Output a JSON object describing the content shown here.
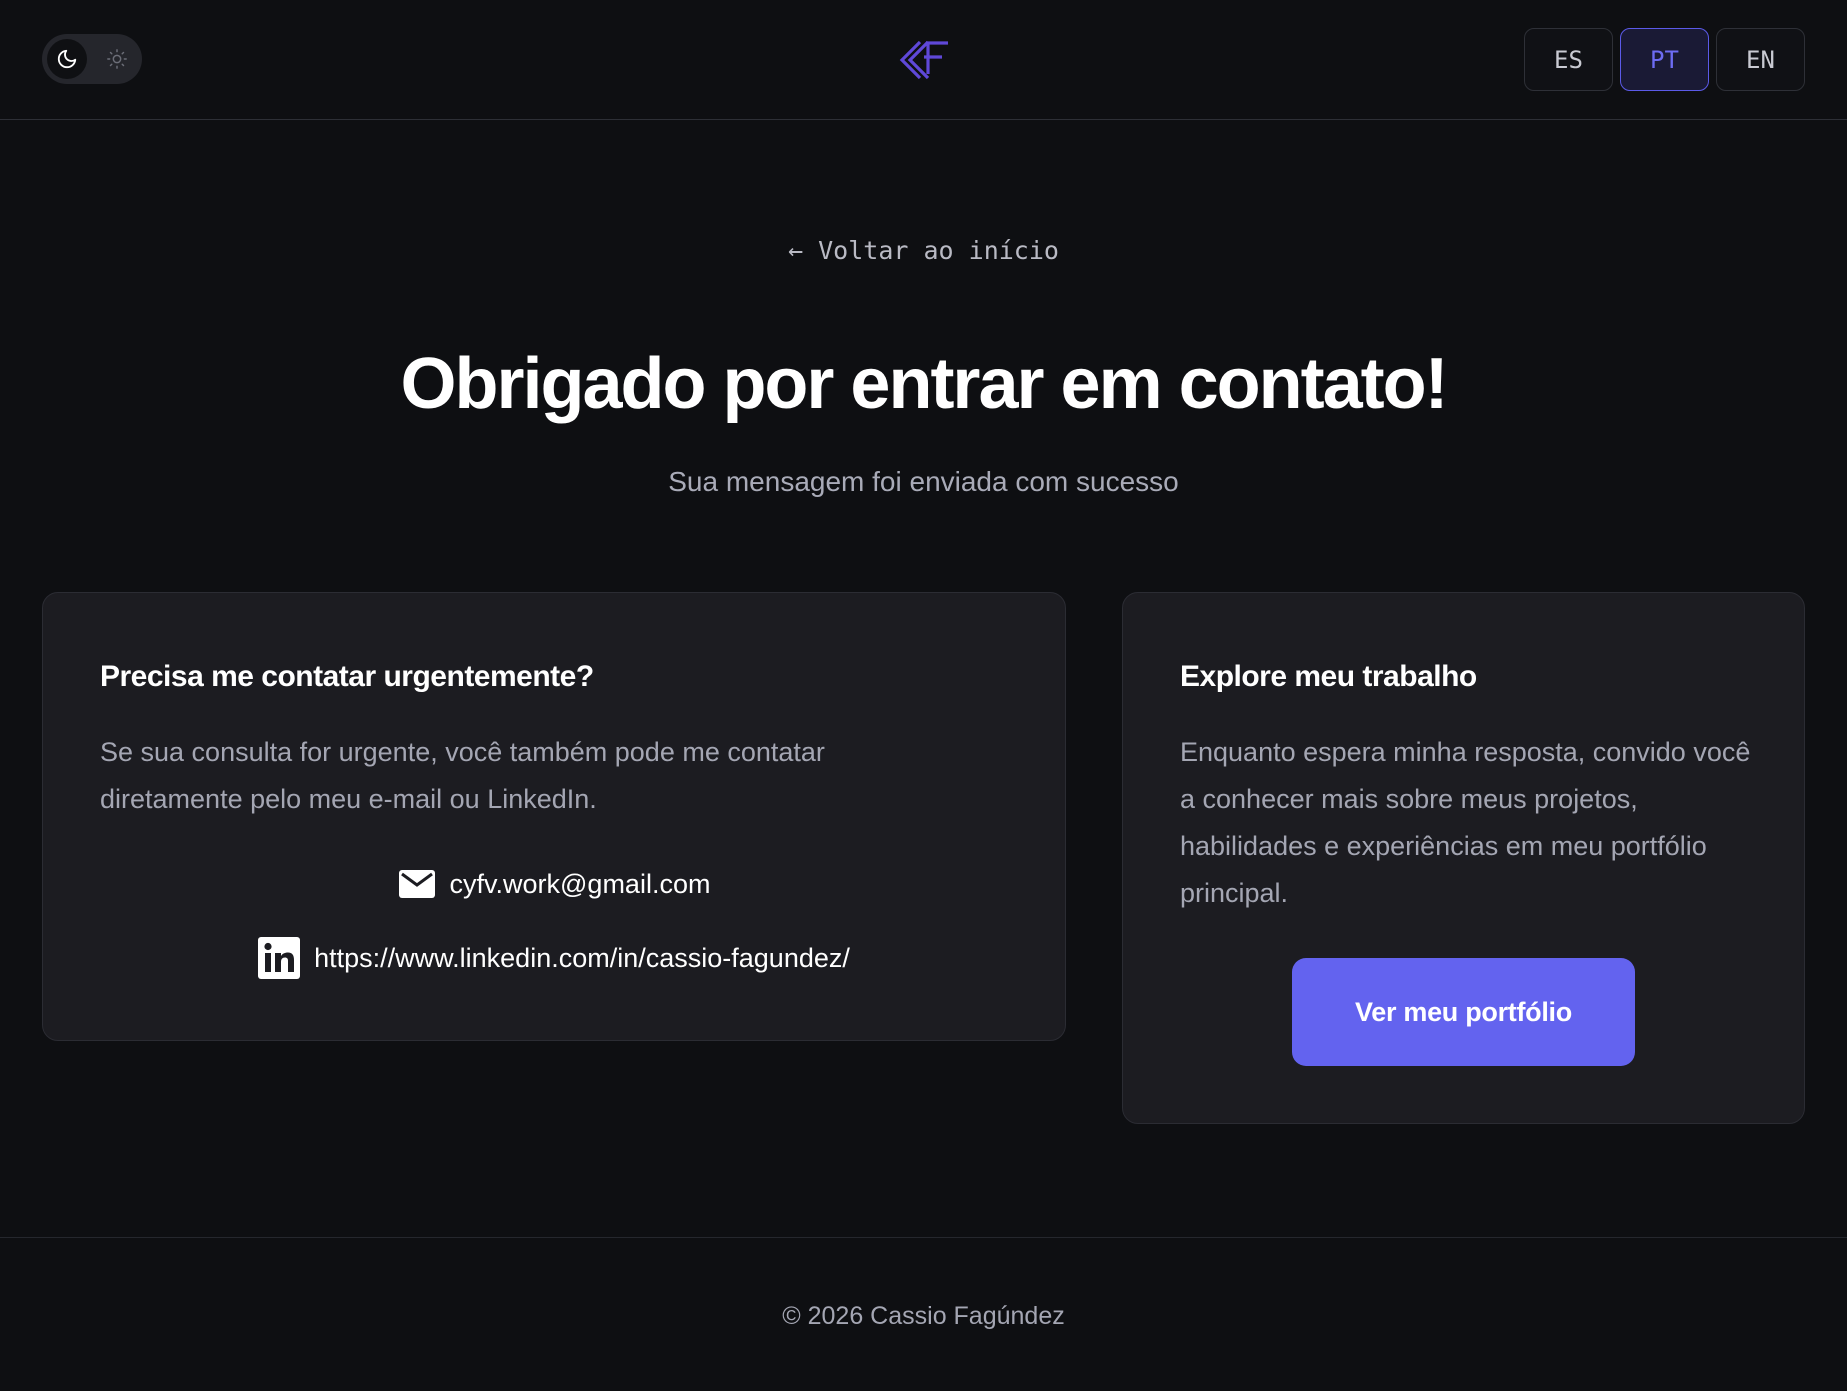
{
  "header": {
    "theme_toggle": {
      "dark_icon": "moon-icon",
      "light_icon": "sun-icon",
      "active": "dark"
    },
    "logo_icon": "brand-logo-icon",
    "languages": [
      {
        "label": "ES",
        "active": false
      },
      {
        "label": "PT",
        "active": true
      },
      {
        "label": "EN",
        "active": false
      }
    ]
  },
  "main": {
    "back_link": "← Voltar ao início",
    "title": "Obrigado por entrar em contato!",
    "subtitle": "Sua mensagem foi enviada com sucesso"
  },
  "contact_card": {
    "title": "Precisa me contatar urgentemente?",
    "text": "Se sua consulta for urgente, você também pode me contatar diretamente pelo meu e-mail ou LinkedIn.",
    "email": "cyfv.work@gmail.com",
    "email_icon": "mail-icon",
    "linkedin": "https://www.linkedin.com/in/cassio-fagundez/",
    "linkedin_icon": "linkedin-icon"
  },
  "explore_card": {
    "title": "Explore meu trabalho",
    "text": "Enquanto espera minha resposta, convido você a conhecer mais sobre meus projetos, habilidades e experiências em meu portfólio principal.",
    "button_label": "Ver meu portfólio"
  },
  "footer": {
    "copyright": "© 2026 Cassio Fagúndez"
  },
  "colors": {
    "background": "#0e0f12",
    "card": "#1c1c21",
    "accent": "#6363ef",
    "text_muted": "#a4a6b3"
  }
}
